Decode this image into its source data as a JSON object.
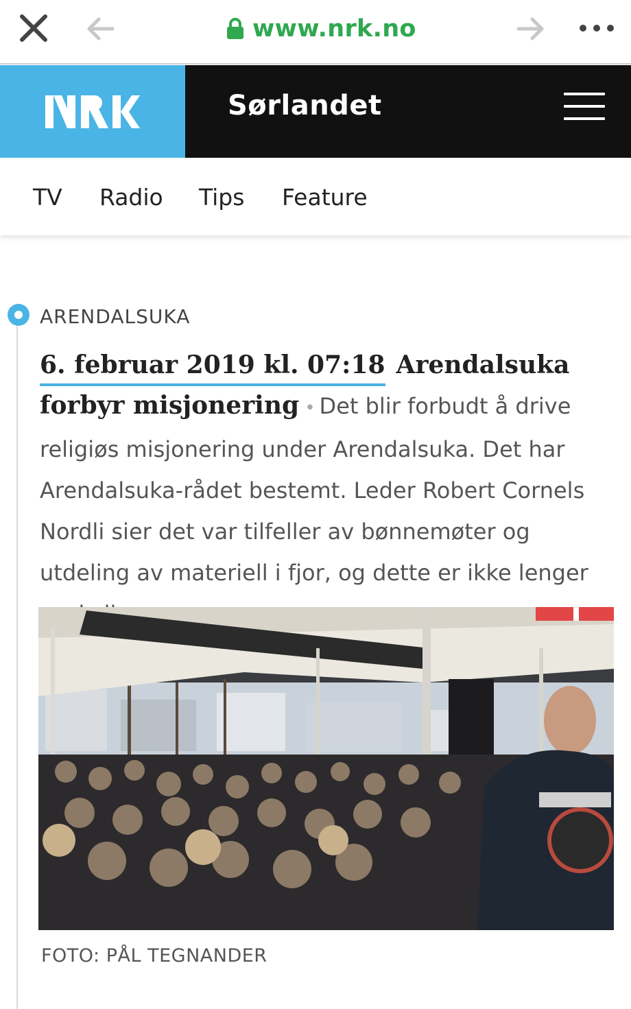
{
  "browser": {
    "url": "www.nrk.no",
    "icons": {
      "close": "close-icon",
      "back": "arrow-left-icon",
      "forward": "arrow-right-icon",
      "lock": "lock-icon",
      "more": "more-dots-icon"
    },
    "url_color": "#2fa84f"
  },
  "header": {
    "logo": "NRK",
    "region": "Sørlandet",
    "menu_icon": "hamburger-menu-icon",
    "logo_bg": "#4ab4e6",
    "bar_bg": "#111111"
  },
  "subnav": {
    "items": [
      {
        "label": "TV"
      },
      {
        "label": "Radio"
      },
      {
        "label": "Tips"
      },
      {
        "label": "Feature"
      }
    ]
  },
  "article": {
    "section": "ARENDALSUKA",
    "date": "6. februar 2019 kl. 07:18",
    "title": "Arendalsuka forbyr misjonering",
    "separator": "•",
    "lead": "Det blir forbudt å drive religiøs misjonering under Arendalsuka. Det har Arendalsuka-rådet bestemt. Leder Robert Cornels Nordli sier det var tilfeller av bønnemøter og utdeling av materiell i fjor, og dette er ikke lenger ønskelig.",
    "photo_credit": "FOTO: PÅL TEGNANDER",
    "accent": "#4ab4e6"
  }
}
